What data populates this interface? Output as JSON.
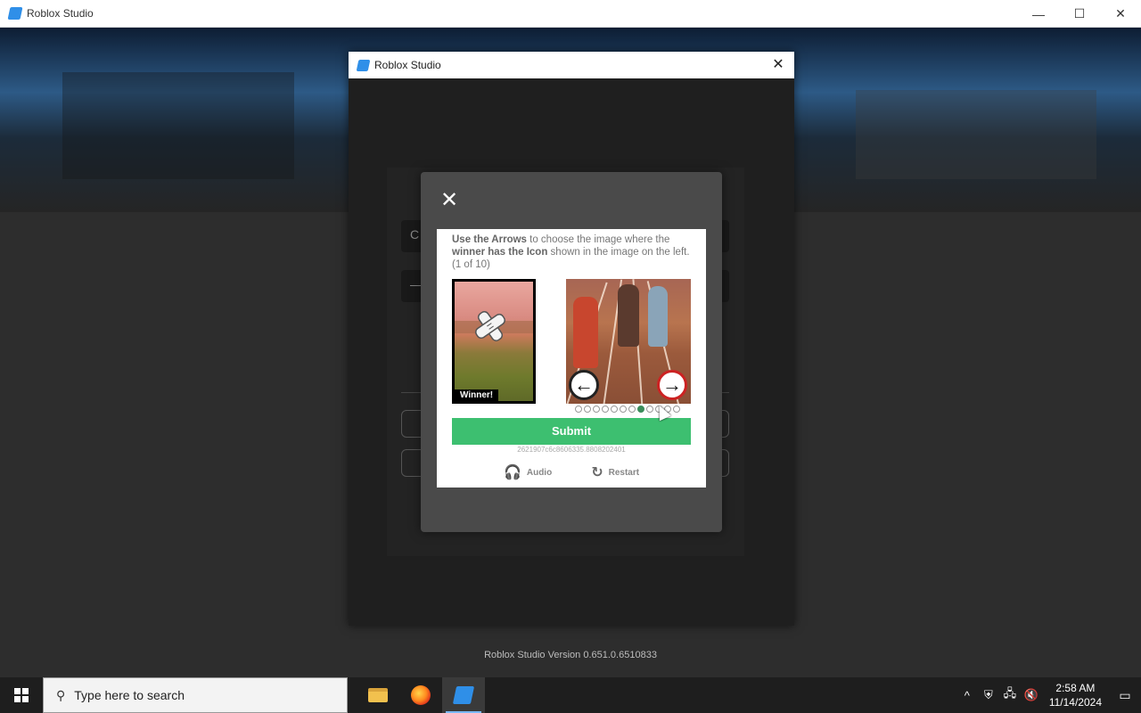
{
  "main_window": {
    "title": "Roblox Studio",
    "controls": {
      "minimize": "—",
      "maximize": "☐",
      "close": "✕"
    }
  },
  "dialog": {
    "title": "Roblox Studio",
    "close": "✕",
    "field1_placeholder": "C",
    "field2_placeholder": "—"
  },
  "captcha": {
    "close": "✕",
    "instructions": {
      "part1": "Use the Arrows",
      "part2": " to choose the image where the ",
      "part3": "winner has the Icon",
      "part4": " shown in the image on the left. (1 of 10)"
    },
    "winner_label": "Winner!",
    "dots_total": 12,
    "dots_active_index": 7,
    "submit_label": "Submit",
    "session_id": "2621907c6c8606335.8808202401",
    "audio_label": "Audio",
    "restart_label": "Restart",
    "left_arrow": "←",
    "right_arrow": "→"
  },
  "version_text": "Roblox Studio Version 0.651.0.6510833",
  "taskbar": {
    "search_placeholder": "Type here to search",
    "time": "2:58 AM",
    "date": "11/14/2024"
  },
  "colors": {
    "submit_green": "#3dbf70",
    "active_dot": "#3a8c5a",
    "roblox_blue": "#2f8fe8"
  }
}
